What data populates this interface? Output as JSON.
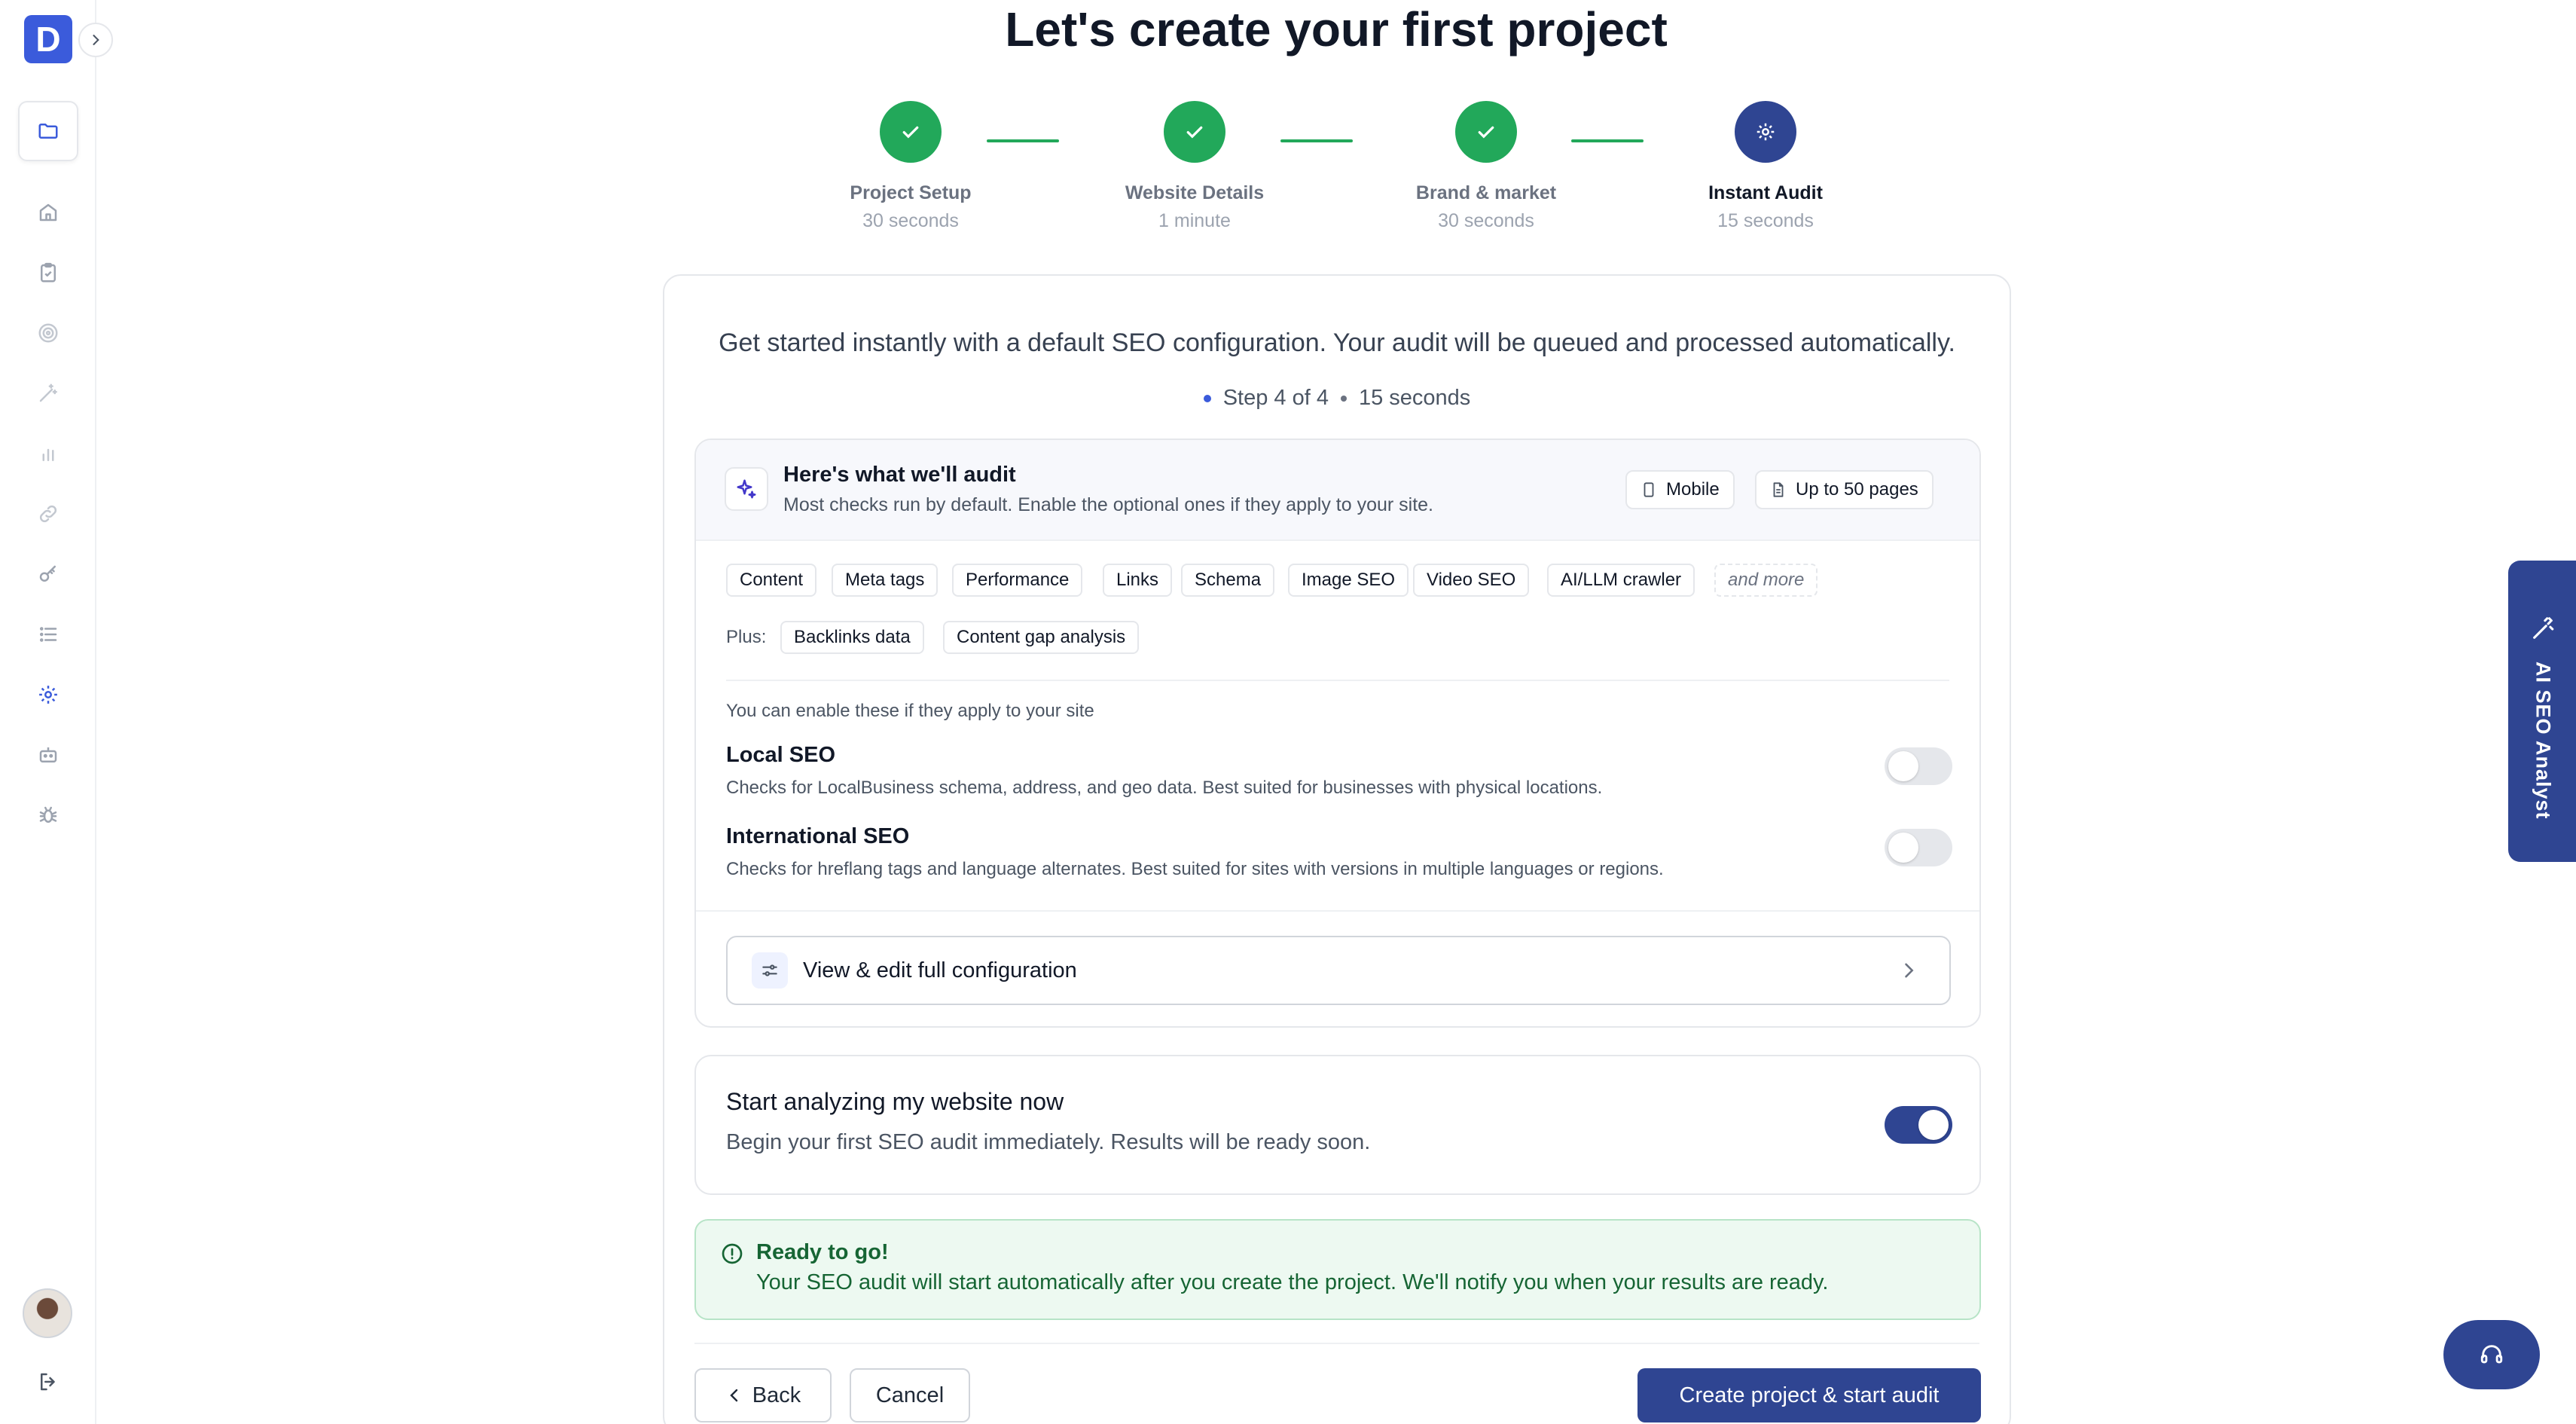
{
  "app": {
    "logo_letter": "D",
    "brand_color": "#3b5bdb",
    "accent_color": "#2f4592",
    "success_color": "#22a85a"
  },
  "sidebar": {
    "items": [
      {
        "icon": "folder-icon",
        "active": true
      },
      {
        "icon": "home-icon"
      },
      {
        "icon": "clipboard-check-icon"
      },
      {
        "icon": "target-icon"
      },
      {
        "icon": "magic-wand-icon"
      },
      {
        "icon": "bar-chart-icon"
      },
      {
        "icon": "link-icon"
      },
      {
        "icon": "key-icon"
      },
      {
        "icon": "list-icon"
      },
      {
        "icon": "gear-icon"
      },
      {
        "icon": "robot-icon"
      },
      {
        "icon": "bug-icon"
      }
    ],
    "logout_icon": "logout-icon"
  },
  "page": {
    "title": "Let's create your first project"
  },
  "stepper": {
    "steps": [
      {
        "name": "Project Setup",
        "time": "30 seconds",
        "status": "done"
      },
      {
        "name": "Website Details",
        "time": "1 minute",
        "status": "done"
      },
      {
        "name": "Brand & market",
        "time": "30 seconds",
        "status": "done"
      },
      {
        "name": "Instant Audit",
        "time": "15 seconds",
        "status": "current"
      }
    ]
  },
  "main": {
    "intro": "Get started instantly with a default SEO configuration. Your audit will be queued and processed automatically.",
    "step_indicator": "Step 4 of 4",
    "step_time": "15 seconds",
    "audit": {
      "title": "Here's what we'll audit",
      "subtitle": "Most checks run by default. Enable the optional ones if they apply to your site.",
      "device_label": "Mobile",
      "pages_label": "Up to 50 pages",
      "checks": [
        "Content",
        "Meta tags",
        "Performance",
        "Links",
        "Schema",
        "Image SEO",
        "Video SEO",
        "AI/LLM crawler"
      ],
      "more_label": "and more",
      "plus_label": "Plus:",
      "plus_items": [
        "Backlinks data",
        "Content gap analysis"
      ],
      "optional_heading": "You can enable these if they apply to your site",
      "optional": [
        {
          "title": "Local SEO",
          "desc": "Checks for LocalBusiness schema, address, and geo data. Best suited for businesses with physical locations.",
          "enabled": false
        },
        {
          "title": "International SEO",
          "desc": "Checks for hreflang tags and language alternates. Best suited for sites with versions in multiple languages or regions.",
          "enabled": false
        }
      ],
      "config_button": "View & edit full configuration"
    },
    "analyze": {
      "title": "Start analyzing my website now",
      "desc": "Begin your first SEO audit immediately. Results will be ready soon.",
      "enabled": true
    },
    "ready": {
      "title": "Ready to go!",
      "desc": "Your SEO audit will start automatically after you create the project. We'll notify you when your results are ready."
    },
    "buttons": {
      "back": "Back",
      "cancel": "Cancel",
      "create": "Create project & start audit"
    }
  },
  "side_tab": {
    "label": "AI SEO Analyst"
  }
}
